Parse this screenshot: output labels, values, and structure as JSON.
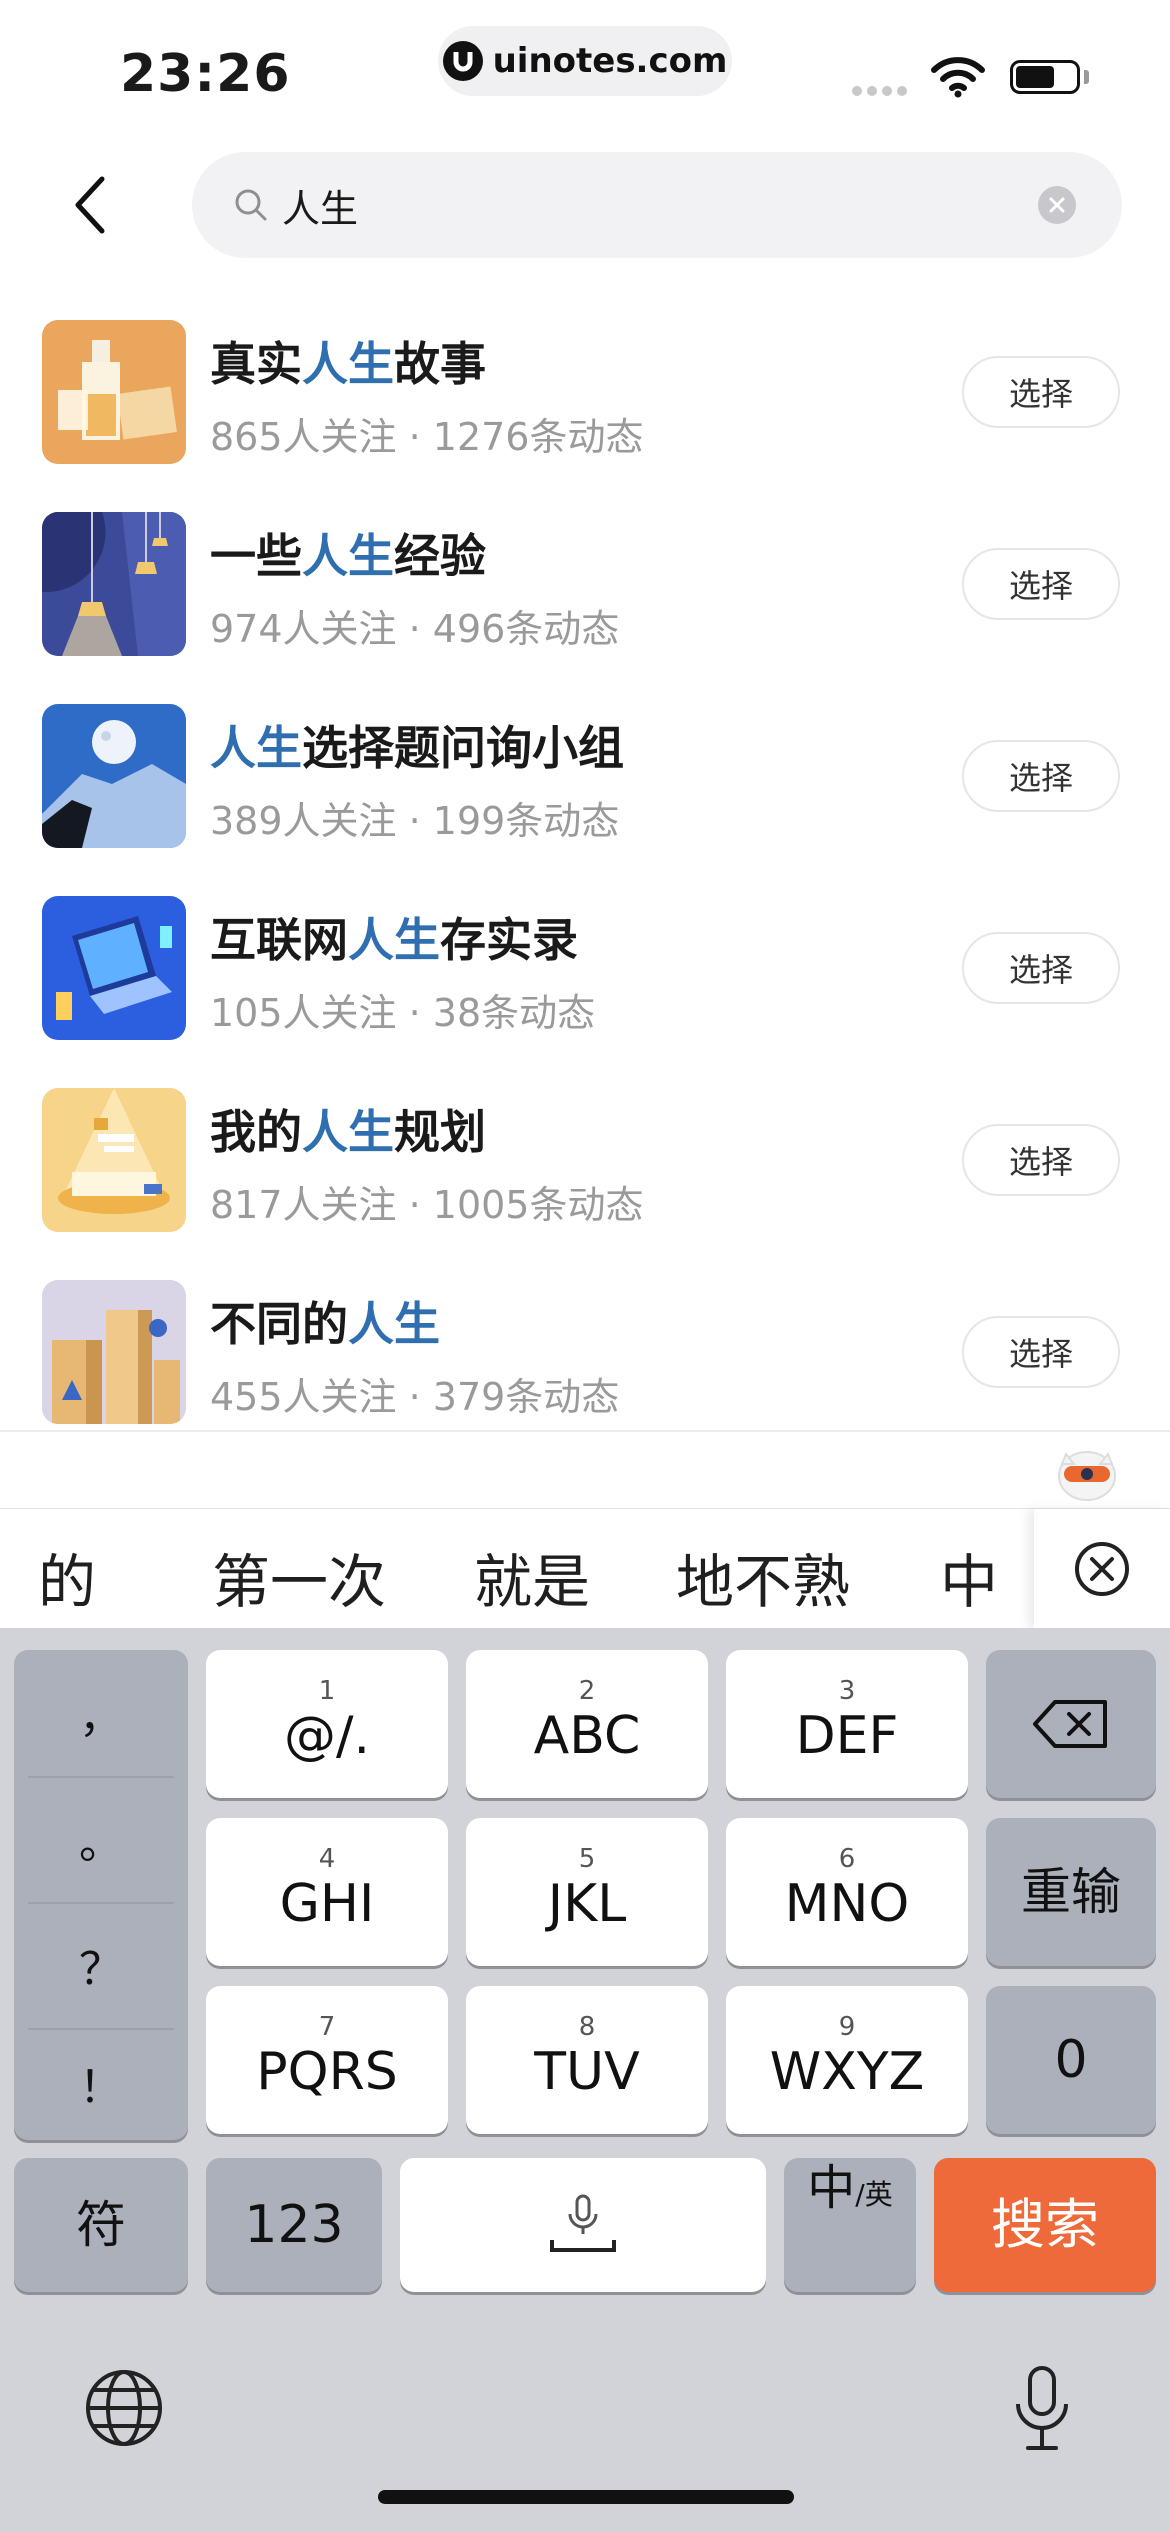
{
  "status_bar": {
    "time": "23:26",
    "url": "uinotes.com",
    "icons": [
      "signal-dots-icon",
      "wifi-icon",
      "battery-icon"
    ]
  },
  "search": {
    "back_icon": "chevron-left-icon",
    "search_icon": "search-icon",
    "query": "人生",
    "clear_icon": "clear-circle-icon"
  },
  "results": [
    {
      "title_pre": "真实",
      "title_hl": "人生",
      "title_post": "故事",
      "meta": "865人关注 · 1276条动态",
      "button": "选择",
      "thumb": "whisky-glass-image"
    },
    {
      "title_pre": "一些",
      "title_hl": "人生",
      "title_post": "经验",
      "meta": "974人关注 · 496条动态",
      "button": "选择",
      "thumb": "lamps-image"
    },
    {
      "title_pre": "",
      "title_hl": "人生",
      "title_post": "选择题问询小组",
      "meta": "389人关注 · 199条动态",
      "button": "选择",
      "thumb": "moon-mountain-image"
    },
    {
      "title_pre": "互联网",
      "title_hl": "人生",
      "title_post": "存实录",
      "meta": "105人关注 · 38条动态",
      "button": "选择",
      "thumb": "laptop-isometric-image"
    },
    {
      "title_pre": "我的",
      "title_hl": "人生",
      "title_post": "规划",
      "meta": "817人关注 · 1005条动态",
      "button": "选择",
      "thumb": "plan-desk-image"
    },
    {
      "title_pre": "不同的",
      "title_hl": "人生",
      "title_post": "",
      "meta": "455人关注 · 379条动态",
      "button": "选择",
      "thumb": "blocks-image"
    }
  ],
  "candidates": {
    "items": [
      "的",
      "第一次",
      "就是",
      "地不熟",
      "中"
    ],
    "close_icon": "close-circle-icon"
  },
  "keyboard": {
    "punctuation": [
      "，",
      "。",
      "？",
      "！"
    ],
    "keys": [
      {
        "num": "1",
        "label": "@/."
      },
      {
        "num": "2",
        "label": "ABC"
      },
      {
        "num": "3",
        "label": "DEF"
      },
      {
        "num": "4",
        "label": "GHI"
      },
      {
        "num": "5",
        "label": "JKL"
      },
      {
        "num": "6",
        "label": "MNO"
      },
      {
        "num": "7",
        "label": "PQRS"
      },
      {
        "num": "8",
        "label": "TUV"
      },
      {
        "num": "9",
        "label": "WXYZ"
      }
    ],
    "backspace_icon": "backspace-icon",
    "reinput": "重输",
    "zero": "0",
    "symbols": "符",
    "numbers": "123",
    "space_icon": "microphone-space-icon",
    "lang_main": "中",
    "lang_sub": "/英",
    "search": "搜索",
    "globe_icon": "globe-icon",
    "mic_icon": "microphone-icon",
    "accent_color": "#ee6a3a"
  }
}
